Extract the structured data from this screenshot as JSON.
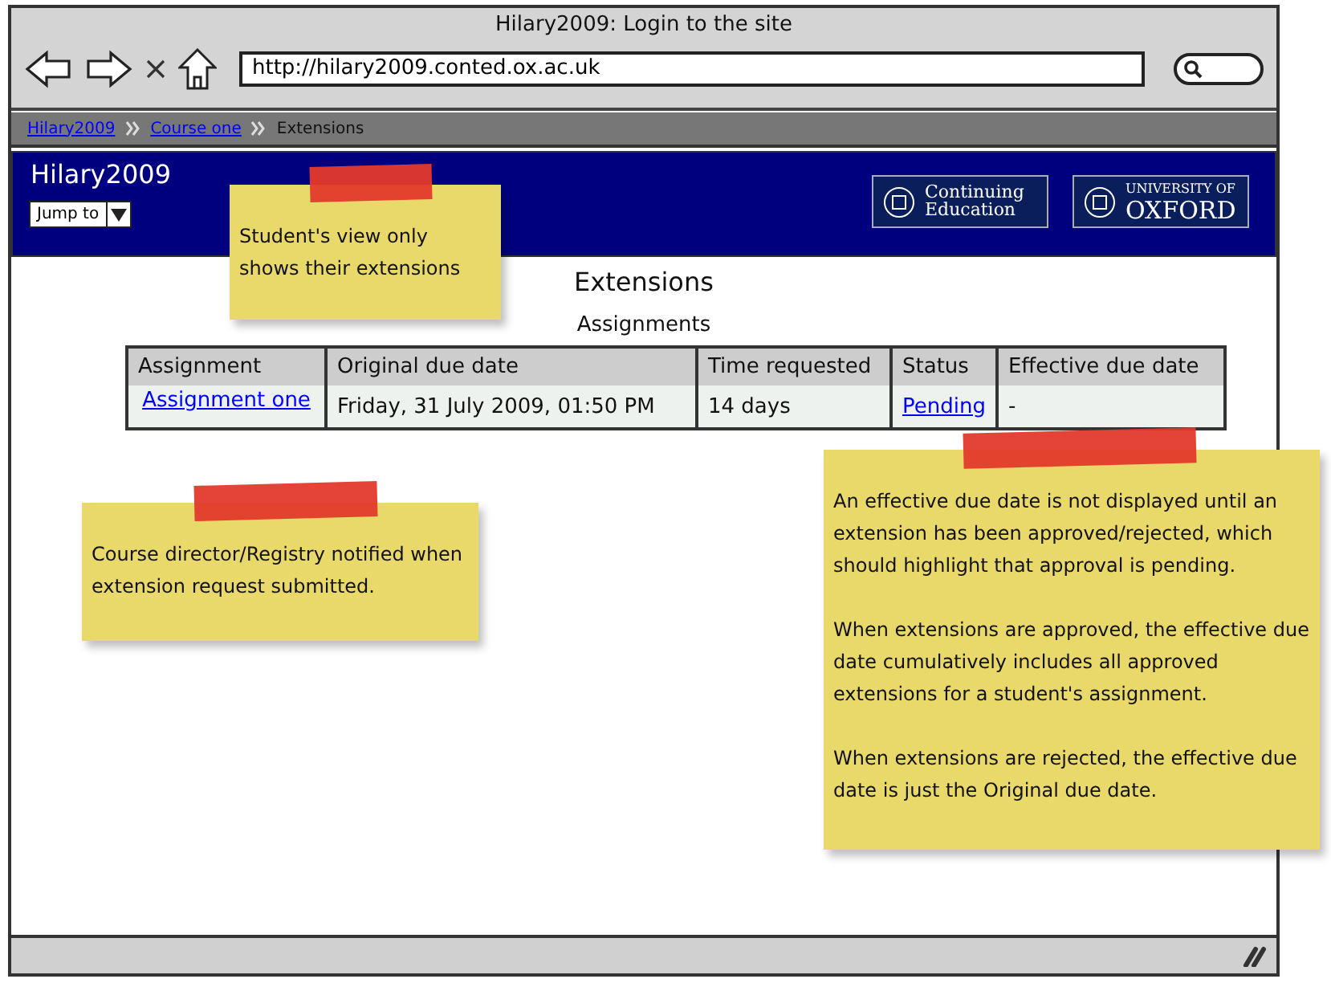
{
  "window": {
    "title": "Hilary2009: Login to the site",
    "address": "http://hilary2009.conted.ox.ac.uk"
  },
  "breadcrumb": [
    {
      "label": "Hilary2009",
      "kind": "link"
    },
    {
      "label": "Course one",
      "kind": "link"
    },
    {
      "label": "Extensions",
      "kind": "current"
    }
  ],
  "header": {
    "site_name": "Hilary2009",
    "jump_menu": "Jump to",
    "logos": [
      {
        "line_1": "Continuing",
        "line_2": "Education"
      },
      {
        "line_1": "UNIVERSITY OF",
        "line_2": "OXFORD"
      }
    ]
  },
  "page": {
    "title": "Extensions",
    "section": "Assignments",
    "table": {
      "columns": [
        "Assignment",
        "Original due date",
        "Time requested",
        "Status",
        "Effective due date"
      ],
      "rows": [
        {
          "cells": [
            {
              "text": "Assignment one",
              "kind": "link"
            },
            {
              "text": "Friday, 31 July 2009, 01:50 PM",
              "kind": "text"
            },
            {
              "text": "14 days",
              "kind": "text"
            },
            {
              "text": "Pending",
              "kind": "link"
            },
            {
              "text": "-",
              "kind": "text"
            }
          ]
        }
      ]
    }
  },
  "notes": [
    {
      "paragraphs": [
        "Student's view only shows their extensions"
      ]
    },
    {
      "paragraphs": [
        "Course director/Registry notified when extension request submitted."
      ]
    },
    {
      "paragraphs": [
        "An effective due date is not displayed until an extension has been approved/rejected, which should highlight that approval is pending.",
        "When extensions are approved, the effective due date cumulatively includes all approved extensions for a student's assignment.",
        "When extensions are rejected, the effective due date is just the Original due date."
      ]
    }
  ]
}
